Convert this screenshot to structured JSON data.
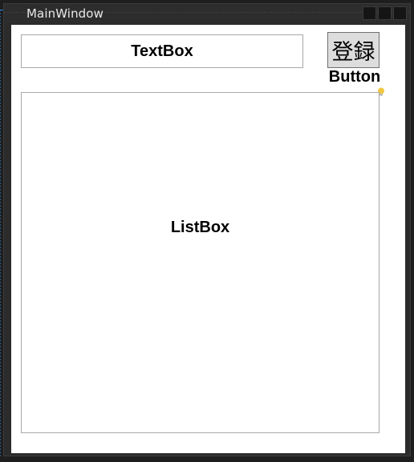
{
  "window": {
    "title": "MainWindow"
  },
  "textbox": {
    "label": "TextBox"
  },
  "button": {
    "label": "登録",
    "caption": "Button"
  },
  "listbox": {
    "label": "ListBox"
  },
  "icons": {
    "lightbulb": "lightbulb-icon"
  },
  "colors": {
    "frame": "#2b2b2b",
    "client": "#ffffff",
    "button_face": "#dddddd",
    "border": "#a8a8a8",
    "guide": "#2f7fd1",
    "bulb": "#f2c744"
  }
}
